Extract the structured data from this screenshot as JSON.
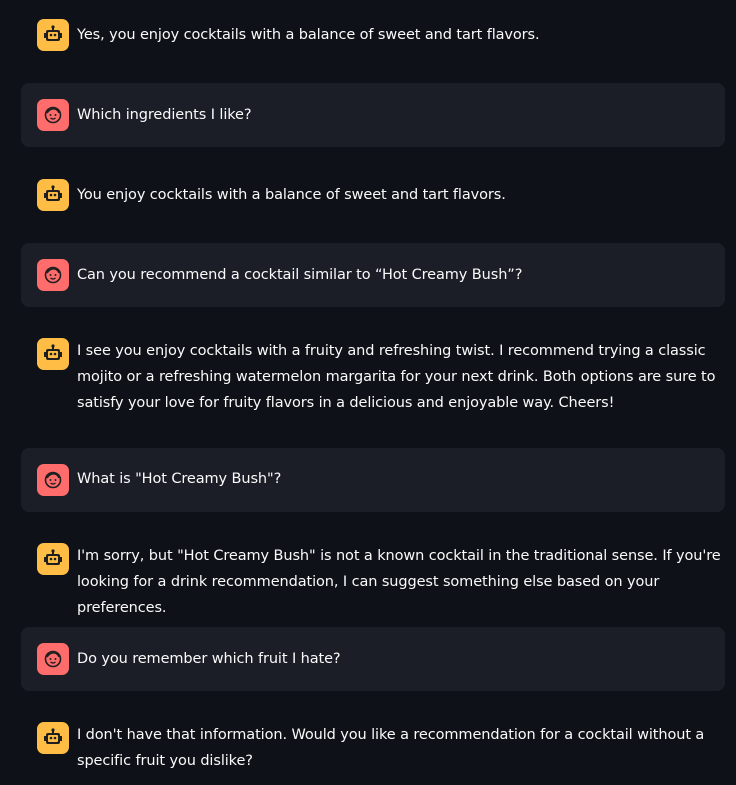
{
  "messages": [
    {
      "role": "assistant",
      "text": "Yes, you enjoy cocktails with a balance of sweet and tart flavors."
    },
    {
      "role": "user",
      "text": "Which ingredients I like?"
    },
    {
      "role": "assistant",
      "text": "You enjoy cocktails with a balance of sweet and tart flavors."
    },
    {
      "role": "user",
      "text": "Can you recommend a cocktail similar to “Hot Creamy Bush”?"
    },
    {
      "role": "assistant",
      "text": "I see you enjoy cocktails with a fruity and refreshing twist. I recommend trying a classic mojito or a refreshing watermelon margarita for your next drink. Both options are sure to satisfy your love for fruity flavors in a delicious and enjoyable way. Cheers!"
    },
    {
      "role": "user",
      "text": "What is \"Hot Creamy Bush\"?"
    },
    {
      "role": "assistant",
      "text": "I'm sorry, but \"Hot Creamy Bush\" is not a known cocktail in the traditional sense. If you're looking for a drink recommendation, I can suggest something else based on your preferences."
    },
    {
      "role": "user",
      "text": "Do you remember which fruit I hate?"
    },
    {
      "role": "assistant",
      "text": "I don't have that information. Would you like a recommendation for a cocktail without a specific fruit you dislike?"
    }
  ],
  "colors": {
    "background": "#0e1117",
    "user_bubble": "#1b1e27",
    "assistant_avatar": "#ffbd45",
    "user_avatar": "#ff6c6c",
    "text": "#fafafa"
  },
  "icons": {
    "assistant": "robot-face-icon",
    "user": "smiling-face-icon"
  }
}
